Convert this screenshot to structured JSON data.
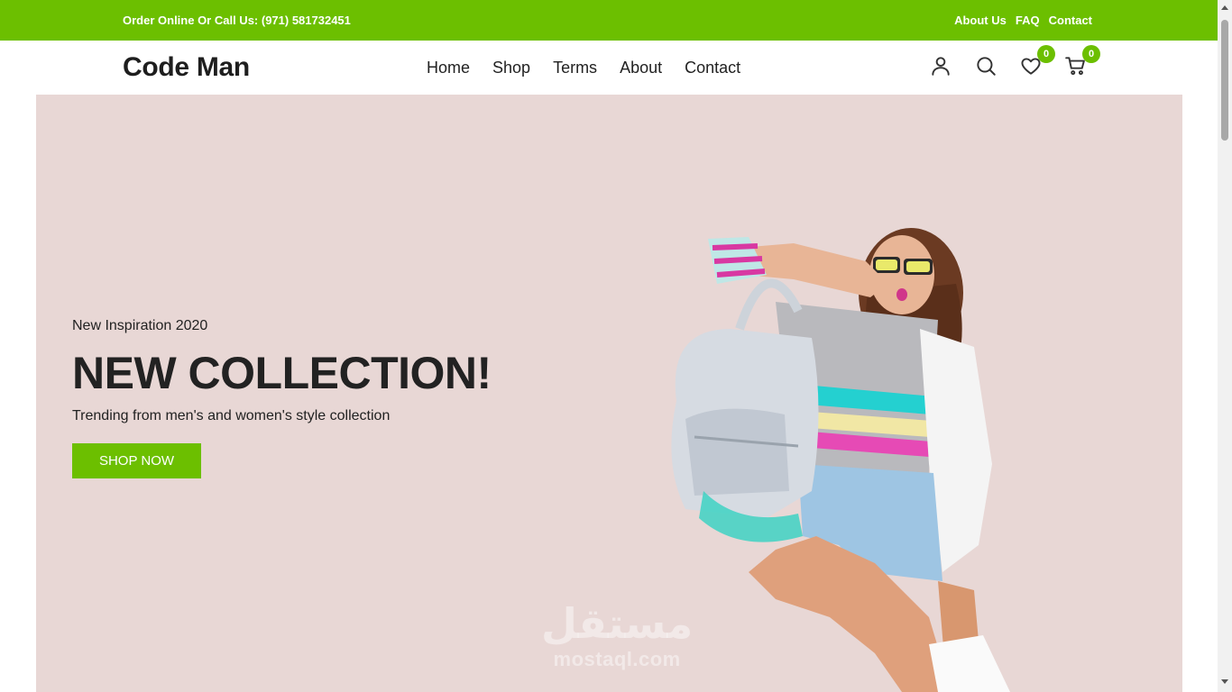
{
  "topbar": {
    "phone_text": "Order Online Or Call Us: (971) 581732451",
    "links": [
      "About Us",
      "FAQ",
      "Contact"
    ],
    "color": "#6cbf00"
  },
  "header": {
    "logo": "Code Man",
    "nav": [
      "Home",
      "Shop",
      "Terms",
      "About",
      "Contact"
    ],
    "icons": [
      "user-icon",
      "search-icon",
      "heart-icon",
      "cart-icon"
    ],
    "wishlist_count": "0",
    "cart_count": "0"
  },
  "hero": {
    "eyebrow": "New Inspiration 2020",
    "headline": "NEW COLLECTION!",
    "subline": "Trending from men's and women's style collection",
    "cta_label": "SHOP NOW",
    "background": "#e8d7d5",
    "watermark_ar": "مستقل",
    "watermark_en": "mostaql.com"
  }
}
